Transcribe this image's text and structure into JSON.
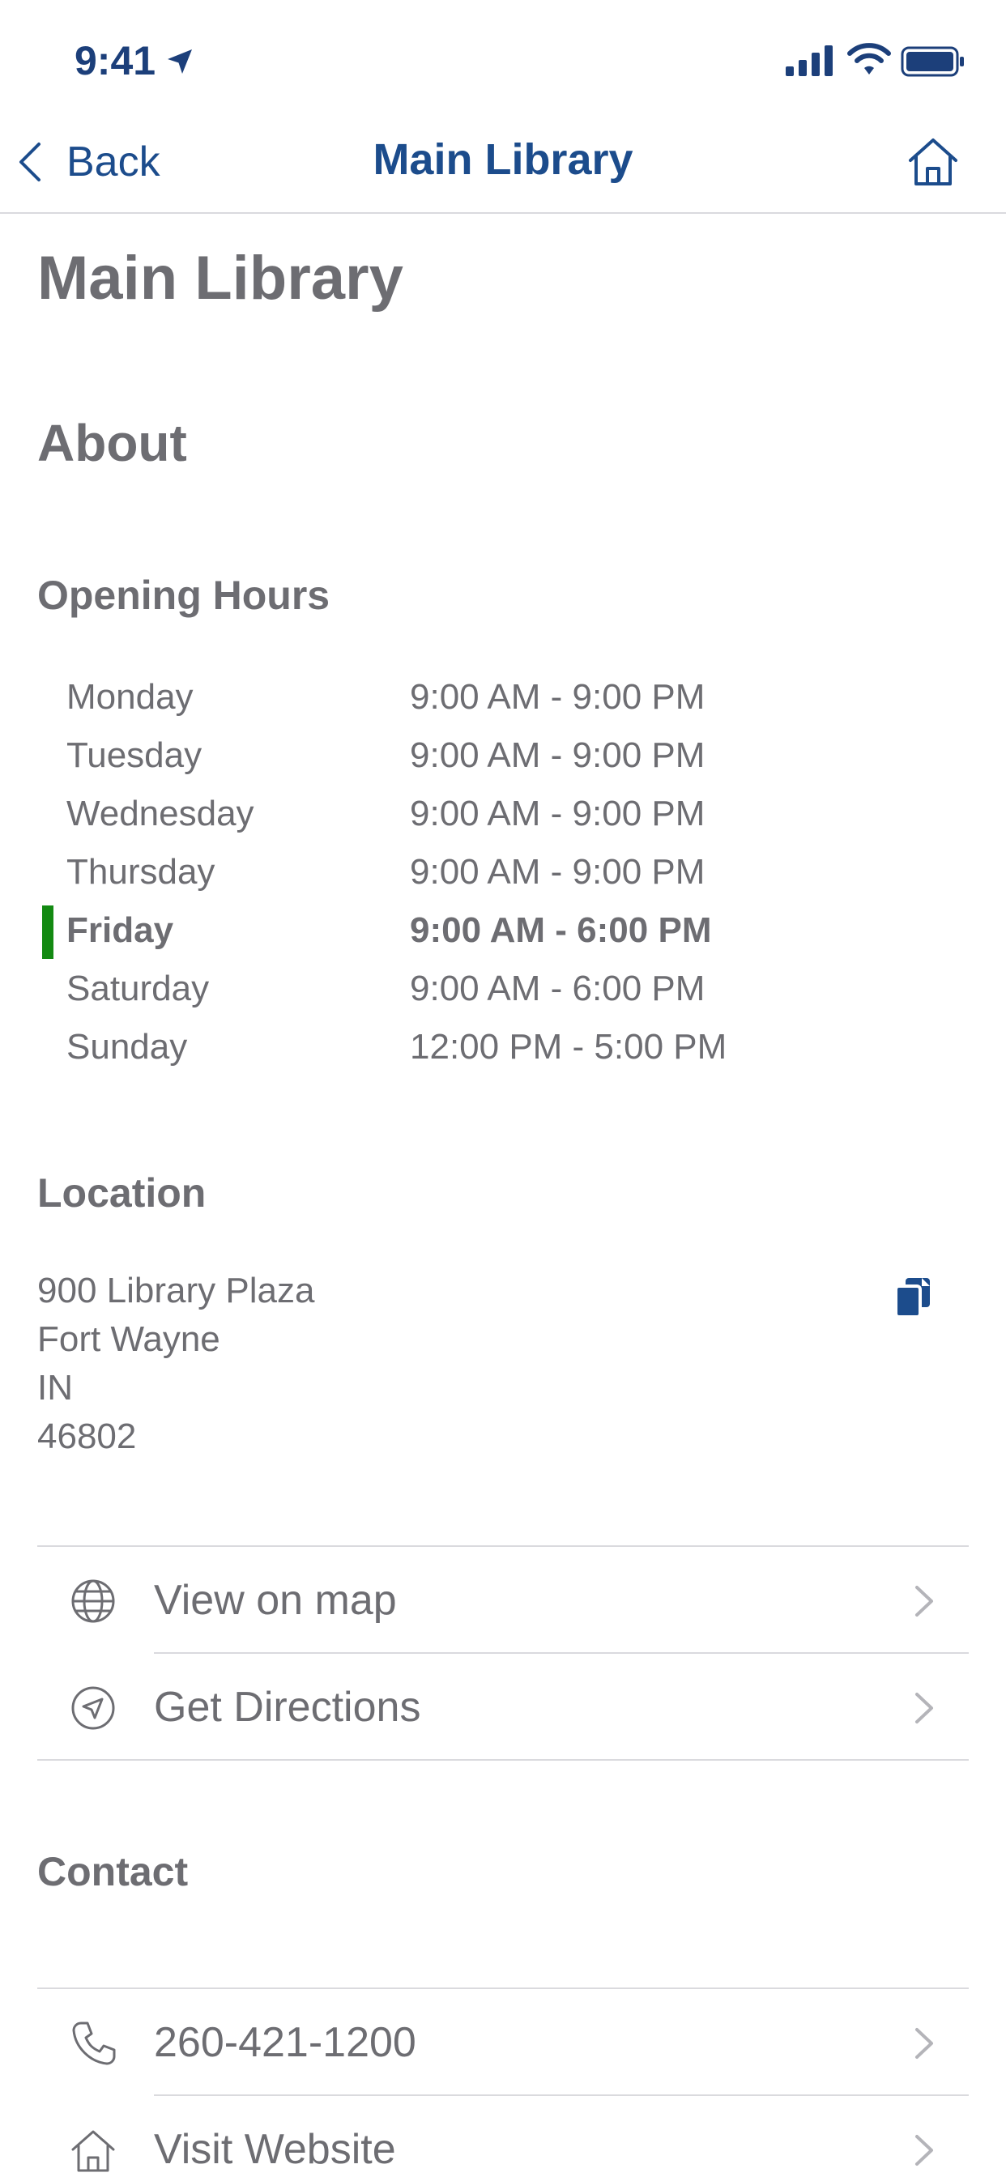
{
  "status": {
    "time": "9:41",
    "accent": "#1c3f7a"
  },
  "nav": {
    "back_label": "Back",
    "title": "Main Library",
    "accent": "#1c4c8c"
  },
  "page": {
    "title": "Main Library",
    "about_heading": "About",
    "hours_heading": "Opening Hours",
    "hours": [
      {
        "day": "Monday",
        "range": "9:00 AM - 9:00 PM",
        "today": false
      },
      {
        "day": "Tuesday",
        "range": "9:00 AM - 9:00 PM",
        "today": false
      },
      {
        "day": "Wednesday",
        "range": "9:00 AM - 9:00 PM",
        "today": false
      },
      {
        "day": "Thursday",
        "range": "9:00 AM - 9:00 PM",
        "today": false
      },
      {
        "day": "Friday",
        "range": "9:00 AM - 6:00 PM",
        "today": true
      },
      {
        "day": "Saturday",
        "range": "9:00 AM - 6:00 PM",
        "today": false
      },
      {
        "day": "Sunday",
        "range": "12:00 PM - 5:00 PM",
        "today": false
      }
    ],
    "today_indicator_color": "#138a12",
    "location_heading": "Location",
    "address": {
      "line1": "900 Library Plaza",
      "city": "Fort Wayne",
      "state": "IN",
      "zip": "46802"
    },
    "location_actions": [
      {
        "label": "View on map",
        "icon": "globe-icon"
      },
      {
        "label": "Get Directions",
        "icon": "navigation-arrow-icon"
      }
    ],
    "contact_heading": "Contact",
    "contact_actions": [
      {
        "label": "260-421-1200",
        "icon": "phone-icon"
      },
      {
        "label": "Visit Website",
        "icon": "home-icon"
      }
    ]
  }
}
